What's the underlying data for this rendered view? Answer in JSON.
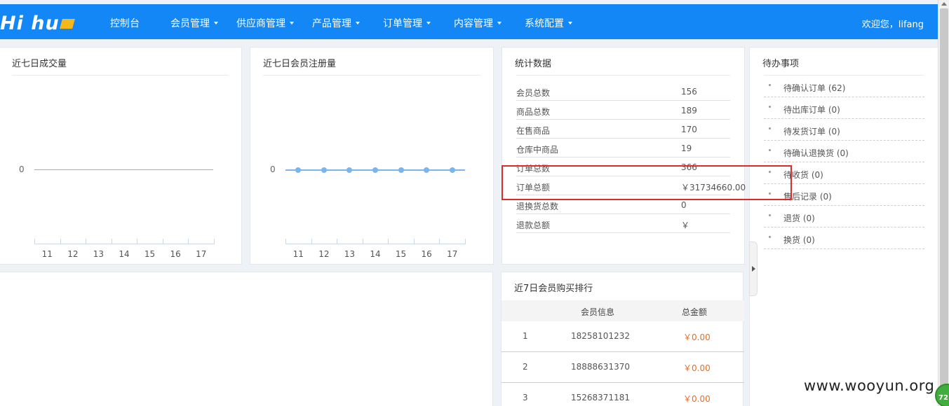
{
  "nav": {
    "logo_text": "Hi hu",
    "items": [
      {
        "label": "控制台",
        "dropdown": false
      },
      {
        "label": "会员管理",
        "dropdown": true
      },
      {
        "label": "供应商管理",
        "dropdown": true
      },
      {
        "label": "产品管理",
        "dropdown": true
      },
      {
        "label": "订单管理",
        "dropdown": true
      },
      {
        "label": "内容管理",
        "dropdown": true
      },
      {
        "label": "系统配置",
        "dropdown": true
      }
    ],
    "welcome": "欢迎您，lifang",
    "bg_color": "#1387f5"
  },
  "panels": {
    "sales": {
      "title": "近七日成交量"
    },
    "signup": {
      "title": "近七日会员注册量"
    },
    "stats": {
      "title": "统计数据",
      "rows": [
        {
          "label": "会员总数",
          "value": "156"
        },
        {
          "label": "商品总数",
          "value": "189"
        },
        {
          "label": "在售商品",
          "value": "170"
        },
        {
          "label": "仓库中商品",
          "value": "19"
        },
        {
          "label": "订单总数",
          "value": "366"
        },
        {
          "label": "订单总额",
          "value": "￥31734660.00"
        },
        {
          "label": "退换货总数",
          "value": "0"
        },
        {
          "label": "退款总额",
          "value": "￥"
        }
      ]
    },
    "todo": {
      "title": "待办事项",
      "items": [
        {
          "label": "待确认订单",
          "count": "(62)"
        },
        {
          "label": "待出库订单",
          "count": "(0)"
        },
        {
          "label": "待发货订单",
          "count": "(0)"
        },
        {
          "label": "待确认退换货",
          "count": "(0)"
        },
        {
          "label": "待收货",
          "count": "(0)"
        },
        {
          "label": "售后记录",
          "count": "(0)"
        },
        {
          "label": "退货",
          "count": "(0)"
        },
        {
          "label": "换货",
          "count": "(0)"
        }
      ]
    },
    "ranking": {
      "title": "近7日会员购买排行",
      "headers": [
        "会员信息",
        "总金额"
      ],
      "rows": [
        {
          "rank": "1",
          "member": "18258101232",
          "amount": "￥0.00"
        },
        {
          "rank": "2",
          "member": "18888631370",
          "amount": "￥0.00"
        },
        {
          "rank": "3",
          "member": "15268371181",
          "amount": "￥0.00"
        }
      ]
    }
  },
  "chart_data": [
    {
      "type": "line",
      "title": "近七日成交量",
      "categories": [
        "11",
        "12",
        "13",
        "14",
        "15",
        "16",
        "17"
      ],
      "values": [
        0,
        0,
        0,
        0,
        0,
        0,
        0
      ],
      "y_ticks": [
        "0"
      ],
      "markers": false
    },
    {
      "type": "line",
      "title": "近七日会员注册量",
      "categories": [
        "11",
        "12",
        "13",
        "14",
        "15",
        "16",
        "17"
      ],
      "values": [
        0,
        0,
        0,
        0,
        0,
        0,
        0
      ],
      "y_ticks": [
        "0"
      ],
      "markers": true,
      "color": "#7cb5ec"
    }
  ],
  "watermark": "www.wooyun.org",
  "badge_text": "72"
}
